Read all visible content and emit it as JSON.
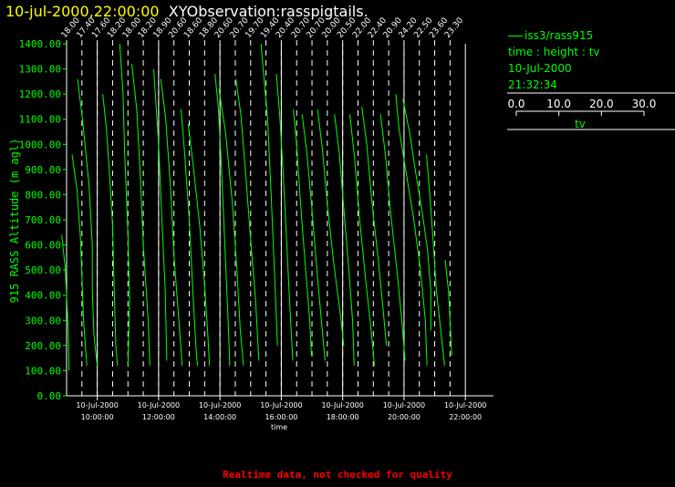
{
  "header": {
    "timestamp": "10-jul-2000,22:00:00",
    "observation": "XYObservation:rasspigtails."
  },
  "legend": {
    "series_label": "iss3/rass915",
    "line2": "time : height : tv",
    "line3": "10-Jul-2000",
    "line4": "21:32:34",
    "scale_ticks": [
      "0.0",
      "10.0",
      "20.0",
      "30.0"
    ],
    "scale_title": "tv"
  },
  "footer": "Realtime data, not checked for quality",
  "colors": {
    "series": "#00ff00",
    "axes": "#ffffff",
    "title_date": "#ffff00",
    "footer": "#ff0000"
  },
  "chart_data": {
    "type": "line",
    "ylabel": "915 RASS Altitude (m agl)",
    "xlabel": "time",
    "ylim": [
      0,
      1400
    ],
    "yticks": [
      "0.00",
      "100.00",
      "200.00",
      "300.00",
      "400.00",
      "500.00",
      "600.00",
      "700.00",
      "800.00",
      "900.00",
      "1000.00",
      "1100.00",
      "1200.00",
      "1300.00",
      "1400.00"
    ],
    "xlim": [
      "10-Jul-2000 09:00:00",
      "10-Jul-2000 22:30:00"
    ],
    "xticks": [
      {
        "date": "10-Jul-2000",
        "time": "10:00:00"
      },
      {
        "date": "10-Jul-2000",
        "time": "12:00:00"
      },
      {
        "date": "10-Jul-2000",
        "time": "14:00:00"
      },
      {
        "date": "10-Jul-2000",
        "time": "16:00:00"
      },
      {
        "date": "10-Jul-2000",
        "time": "18:00:00"
      },
      {
        "date": "10-Jul-2000",
        "time": "20:00:00"
      },
      {
        "date": "10-Jul-2000",
        "time": "22:00:00"
      }
    ],
    "pigtails": [
      {
        "time": "09:00",
        "base": "18.00",
        "pts": [
          [
            -0.3,
            640
          ],
          [
            -0.1,
            520
          ],
          [
            0.0,
            400
          ],
          [
            0.1,
            260
          ],
          [
            0.15,
            100
          ]
        ]
      },
      {
        "time": "09:30",
        "base": "17.40",
        "pts": [
          [
            -0.6,
            960
          ],
          [
            -0.3,
            820
          ],
          [
            -0.1,
            640
          ],
          [
            0.0,
            480
          ],
          [
            0.1,
            300
          ],
          [
            0.3,
            120
          ]
        ]
      },
      {
        "time": "10:00",
        "base": "17.60",
        "pts": [
          [
            -1.2,
            1260
          ],
          [
            -0.9,
            1100
          ],
          [
            -0.5,
            840
          ],
          [
            -0.3,
            600
          ],
          [
            -0.3,
            420
          ],
          [
            -0.2,
            240
          ],
          [
            0.0,
            120
          ]
        ]
      },
      {
        "time": "10:30",
        "base": "18.20",
        "pts": [
          [
            -0.6,
            1200
          ],
          [
            -0.4,
            1080
          ],
          [
            -0.2,
            900
          ],
          [
            0.0,
            680
          ],
          [
            0.1,
            420
          ],
          [
            0.2,
            200
          ],
          [
            0.3,
            120
          ]
        ]
      },
      {
        "time": "11:00",
        "base": "18.00",
        "pts": [
          [
            -0.5,
            1400
          ],
          [
            -0.3,
            1200
          ],
          [
            -0.2,
            960
          ],
          [
            0.0,
            640
          ],
          [
            0.1,
            380
          ],
          [
            0.0,
            120
          ]
        ]
      },
      {
        "time": "11:30",
        "base": "18.20",
        "pts": [
          [
            -0.7,
            1320
          ],
          [
            -0.4,
            1140
          ],
          [
            -0.2,
            900
          ],
          [
            0.0,
            600
          ],
          [
            0.3,
            300
          ],
          [
            0.4,
            120
          ]
        ]
      },
      {
        "time": "12:00",
        "base": "18.90",
        "pts": [
          [
            -0.3,
            1300
          ],
          [
            -0.2,
            1200
          ],
          [
            0.0,
            1000
          ],
          [
            0.2,
            700
          ],
          [
            0.4,
            420
          ],
          [
            0.5,
            140
          ]
        ]
      },
      {
        "time": "12:30",
        "base": "20.60",
        "pts": [
          [
            -0.8,
            1260
          ],
          [
            -0.5,
            1100
          ],
          [
            -0.2,
            820
          ],
          [
            0.0,
            560
          ],
          [
            0.3,
            300
          ],
          [
            0.5,
            120
          ]
        ]
      },
      {
        "time": "13:00",
        "base": "18.60",
        "pts": [
          [
            -0.5,
            1140
          ],
          [
            -0.3,
            980
          ],
          [
            0.0,
            700
          ],
          [
            0.2,
            440
          ],
          [
            0.4,
            200
          ],
          [
            0.5,
            120
          ]
        ]
      },
      {
        "time": "13:30",
        "base": "18.80",
        "pts": [
          [
            -1.0,
            1080
          ],
          [
            -0.7,
            920
          ],
          [
            -0.3,
            680
          ],
          [
            0.0,
            440
          ],
          [
            0.2,
            240
          ],
          [
            0.3,
            120
          ]
        ]
      },
      {
        "time": "14:00",
        "base": "20.60",
        "pts": [
          [
            -0.3,
            1280
          ],
          [
            -0.1,
            1150
          ],
          [
            0.1,
            900
          ],
          [
            0.3,
            600
          ],
          [
            0.5,
            300
          ],
          [
            0.6,
            120
          ]
        ]
      },
      {
        "time": "14:30",
        "base": "20.70",
        "pts": [
          [
            -1.0,
            1220
          ],
          [
            -0.6,
            1050
          ],
          [
            -0.2,
            780
          ],
          [
            0.1,
            500
          ],
          [
            0.3,
            260
          ],
          [
            0.5,
            120
          ]
        ]
      },
      {
        "time": "15:00",
        "base": "19.70",
        "pts": [
          [
            -0.9,
            1260
          ],
          [
            -0.6,
            1120
          ],
          [
            -0.3,
            880
          ],
          [
            0.0,
            620
          ],
          [
            0.3,
            380
          ],
          [
            0.5,
            140
          ]
        ]
      },
      {
        "time": "15:30",
        "base": "19.40",
        "pts": [
          [
            -0.3,
            1400
          ],
          [
            -0.2,
            1320
          ],
          [
            0.1,
            1100
          ],
          [
            0.3,
            820
          ],
          [
            0.5,
            520
          ],
          [
            0.7,
            200
          ]
        ]
      },
      {
        "time": "16:00",
        "base": "20.40",
        "pts": [
          [
            -0.3,
            1280
          ],
          [
            -0.1,
            1120
          ],
          [
            0.1,
            900
          ],
          [
            0.3,
            650
          ],
          [
            0.5,
            380
          ],
          [
            0.7,
            140
          ]
        ]
      },
      {
        "time": "16:30",
        "base": "20.70",
        "pts": [
          [
            -0.2,
            1140
          ],
          [
            0.0,
            1000
          ],
          [
            0.2,
            800
          ],
          [
            0.5,
            540
          ],
          [
            0.8,
            300
          ],
          [
            0.9,
            160
          ]
        ]
      },
      {
        "time": "17:00",
        "base": "20.70",
        "pts": [
          [
            -0.6,
            1120
          ],
          [
            -0.3,
            960
          ],
          [
            0.0,
            740
          ],
          [
            0.3,
            500
          ],
          [
            0.6,
            280
          ],
          [
            0.8,
            140
          ]
        ]
      },
      {
        "time": "17:30",
        "base": "20.00",
        "pts": [
          [
            -0.6,
            1140
          ],
          [
            -0.3,
            980
          ],
          [
            0.0,
            760
          ],
          [
            0.4,
            520
          ],
          [
            0.8,
            320
          ],
          [
            1.0,
            200
          ]
        ]
      },
      {
        "time": "18:00",
        "base": "20.50",
        "pts": [
          [
            -0.5,
            1120
          ],
          [
            -0.2,
            960
          ],
          [
            0.1,
            720
          ],
          [
            0.4,
            480
          ],
          [
            0.6,
            300
          ],
          [
            0.7,
            120
          ]
        ]
      },
      {
        "time": "18:30",
        "base": "22.00",
        "pts": [
          [
            -0.5,
            1120
          ],
          [
            -0.2,
            940
          ],
          [
            0.1,
            700
          ],
          [
            0.5,
            440
          ],
          [
            0.8,
            260
          ],
          [
            1.0,
            120
          ]
        ]
      },
      {
        "time": "19:00",
        "base": "22.40",
        "pts": [
          [
            -0.7,
            1150
          ],
          [
            -0.4,
            1000
          ],
          [
            -0.1,
            780
          ],
          [
            0.3,
            540
          ],
          [
            0.6,
            340
          ],
          [
            0.8,
            200
          ]
        ]
      },
      {
        "time": "19:30",
        "base": "20.90",
        "pts": [
          [
            -0.5,
            1120
          ],
          [
            -0.2,
            960
          ],
          [
            0.1,
            740
          ],
          [
            0.5,
            500
          ],
          [
            0.8,
            300
          ],
          [
            1.0,
            140
          ]
        ]
      },
      {
        "time": "20:00",
        "base": "24.20",
        "pts": [
          [
            -0.5,
            1200
          ],
          [
            -0.3,
            1060
          ],
          [
            0.1,
            900
          ],
          [
            0.6,
            700
          ],
          [
            1.0,
            500
          ],
          [
            1.3,
            300
          ],
          [
            1.4,
            120
          ]
        ]
      },
      {
        "time": "20:30",
        "base": "22.50",
        "pts": [
          [
            -1.0,
            1180
          ],
          [
            -0.6,
            1050
          ],
          [
            -0.2,
            880
          ],
          [
            0.2,
            720
          ],
          [
            0.5,
            580
          ],
          [
            0.7,
            420
          ],
          [
            0.7,
            260
          ]
        ]
      },
      {
        "time": "21:00",
        "base": "23.60",
        "pts": [
          [
            -0.5,
            960
          ],
          [
            -0.3,
            800
          ],
          [
            -0.1,
            620
          ],
          [
            0.1,
            420
          ],
          [
            0.4,
            240
          ],
          [
            0.6,
            120
          ]
        ]
      },
      {
        "time": "21:30",
        "base": "23.30",
        "pts": [
          [
            -0.3,
            540
          ],
          [
            -0.1,
            420
          ],
          [
            0.0,
            300
          ],
          [
            0.1,
            160
          ]
        ]
      }
    ]
  }
}
